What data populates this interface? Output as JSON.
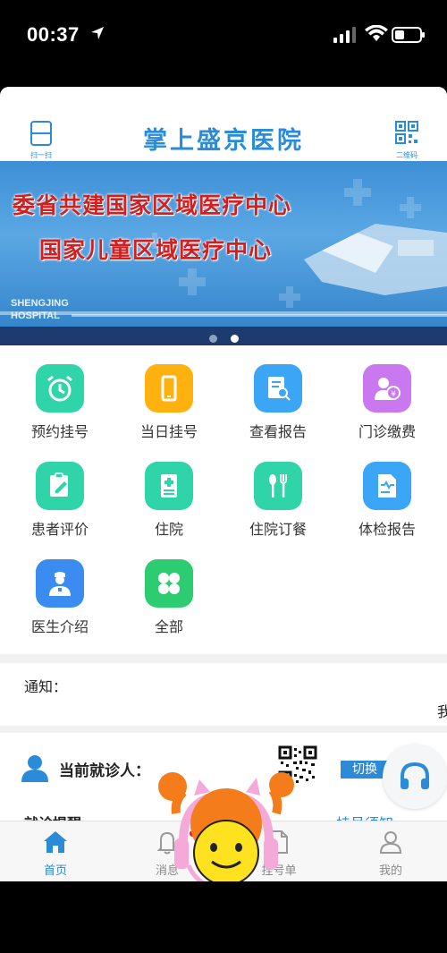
{
  "status": {
    "time": "00:37"
  },
  "header": {
    "title": "掌上盛京医院",
    "scan_label": "扫一扫",
    "qr_label": "二维码"
  },
  "banner": {
    "line1": "委省共建国家区域医疗中心",
    "line2": "国家儿童区域医疗中心",
    "en_line1": "SHENGJING",
    "en_line2": "HOSPITAL",
    "active_slide": 2,
    "slide_count": 2
  },
  "services": [
    {
      "label": "预约挂号",
      "icon": "alarm-clock-icon",
      "color": "#2fd4a8"
    },
    {
      "label": "当日挂号",
      "icon": "phone-icon",
      "color": "#ffb20f"
    },
    {
      "label": "查看报告",
      "icon": "report-search-icon",
      "color": "#3aa6f5"
    },
    {
      "label": "门诊缴费",
      "icon": "payment-icon",
      "color": "#c978ef"
    },
    {
      "label": "患者评价",
      "icon": "edit-note-icon",
      "color": "#2fd4a8"
    },
    {
      "label": "住院",
      "icon": "hospital-record-icon",
      "color": "#2fd4a8"
    },
    {
      "label": "住院订餐",
      "icon": "fork-spoon-icon",
      "color": "#2fd4a8"
    },
    {
      "label": "体检报告",
      "icon": "checkup-report-icon",
      "color": "#3aa6f5"
    },
    {
      "label": "医生介绍",
      "icon": "doctor-icon",
      "color": "#3a8cf0"
    },
    {
      "label": "全部",
      "icon": "all-grid-icon",
      "color": "#2ecc71"
    }
  ],
  "notice": {
    "label": "通知：",
    "edge_text": "我"
  },
  "patient": {
    "label": "当前就诊人：",
    "switch_label": "切换"
  },
  "reminder": {
    "label": "就诊提醒",
    "right_label": "挂号须知"
  },
  "tabbar": [
    {
      "label": "首页",
      "icon": "home-icon",
      "active": true
    },
    {
      "label": "消息",
      "icon": "bell-icon",
      "active": false
    },
    {
      "label": "挂号单",
      "icon": "document-icon",
      "active": false
    },
    {
      "label": "我的",
      "icon": "user-icon",
      "active": false
    }
  ],
  "colors": {
    "accent": "#2a8bd8",
    "badge": "#e02020"
  }
}
